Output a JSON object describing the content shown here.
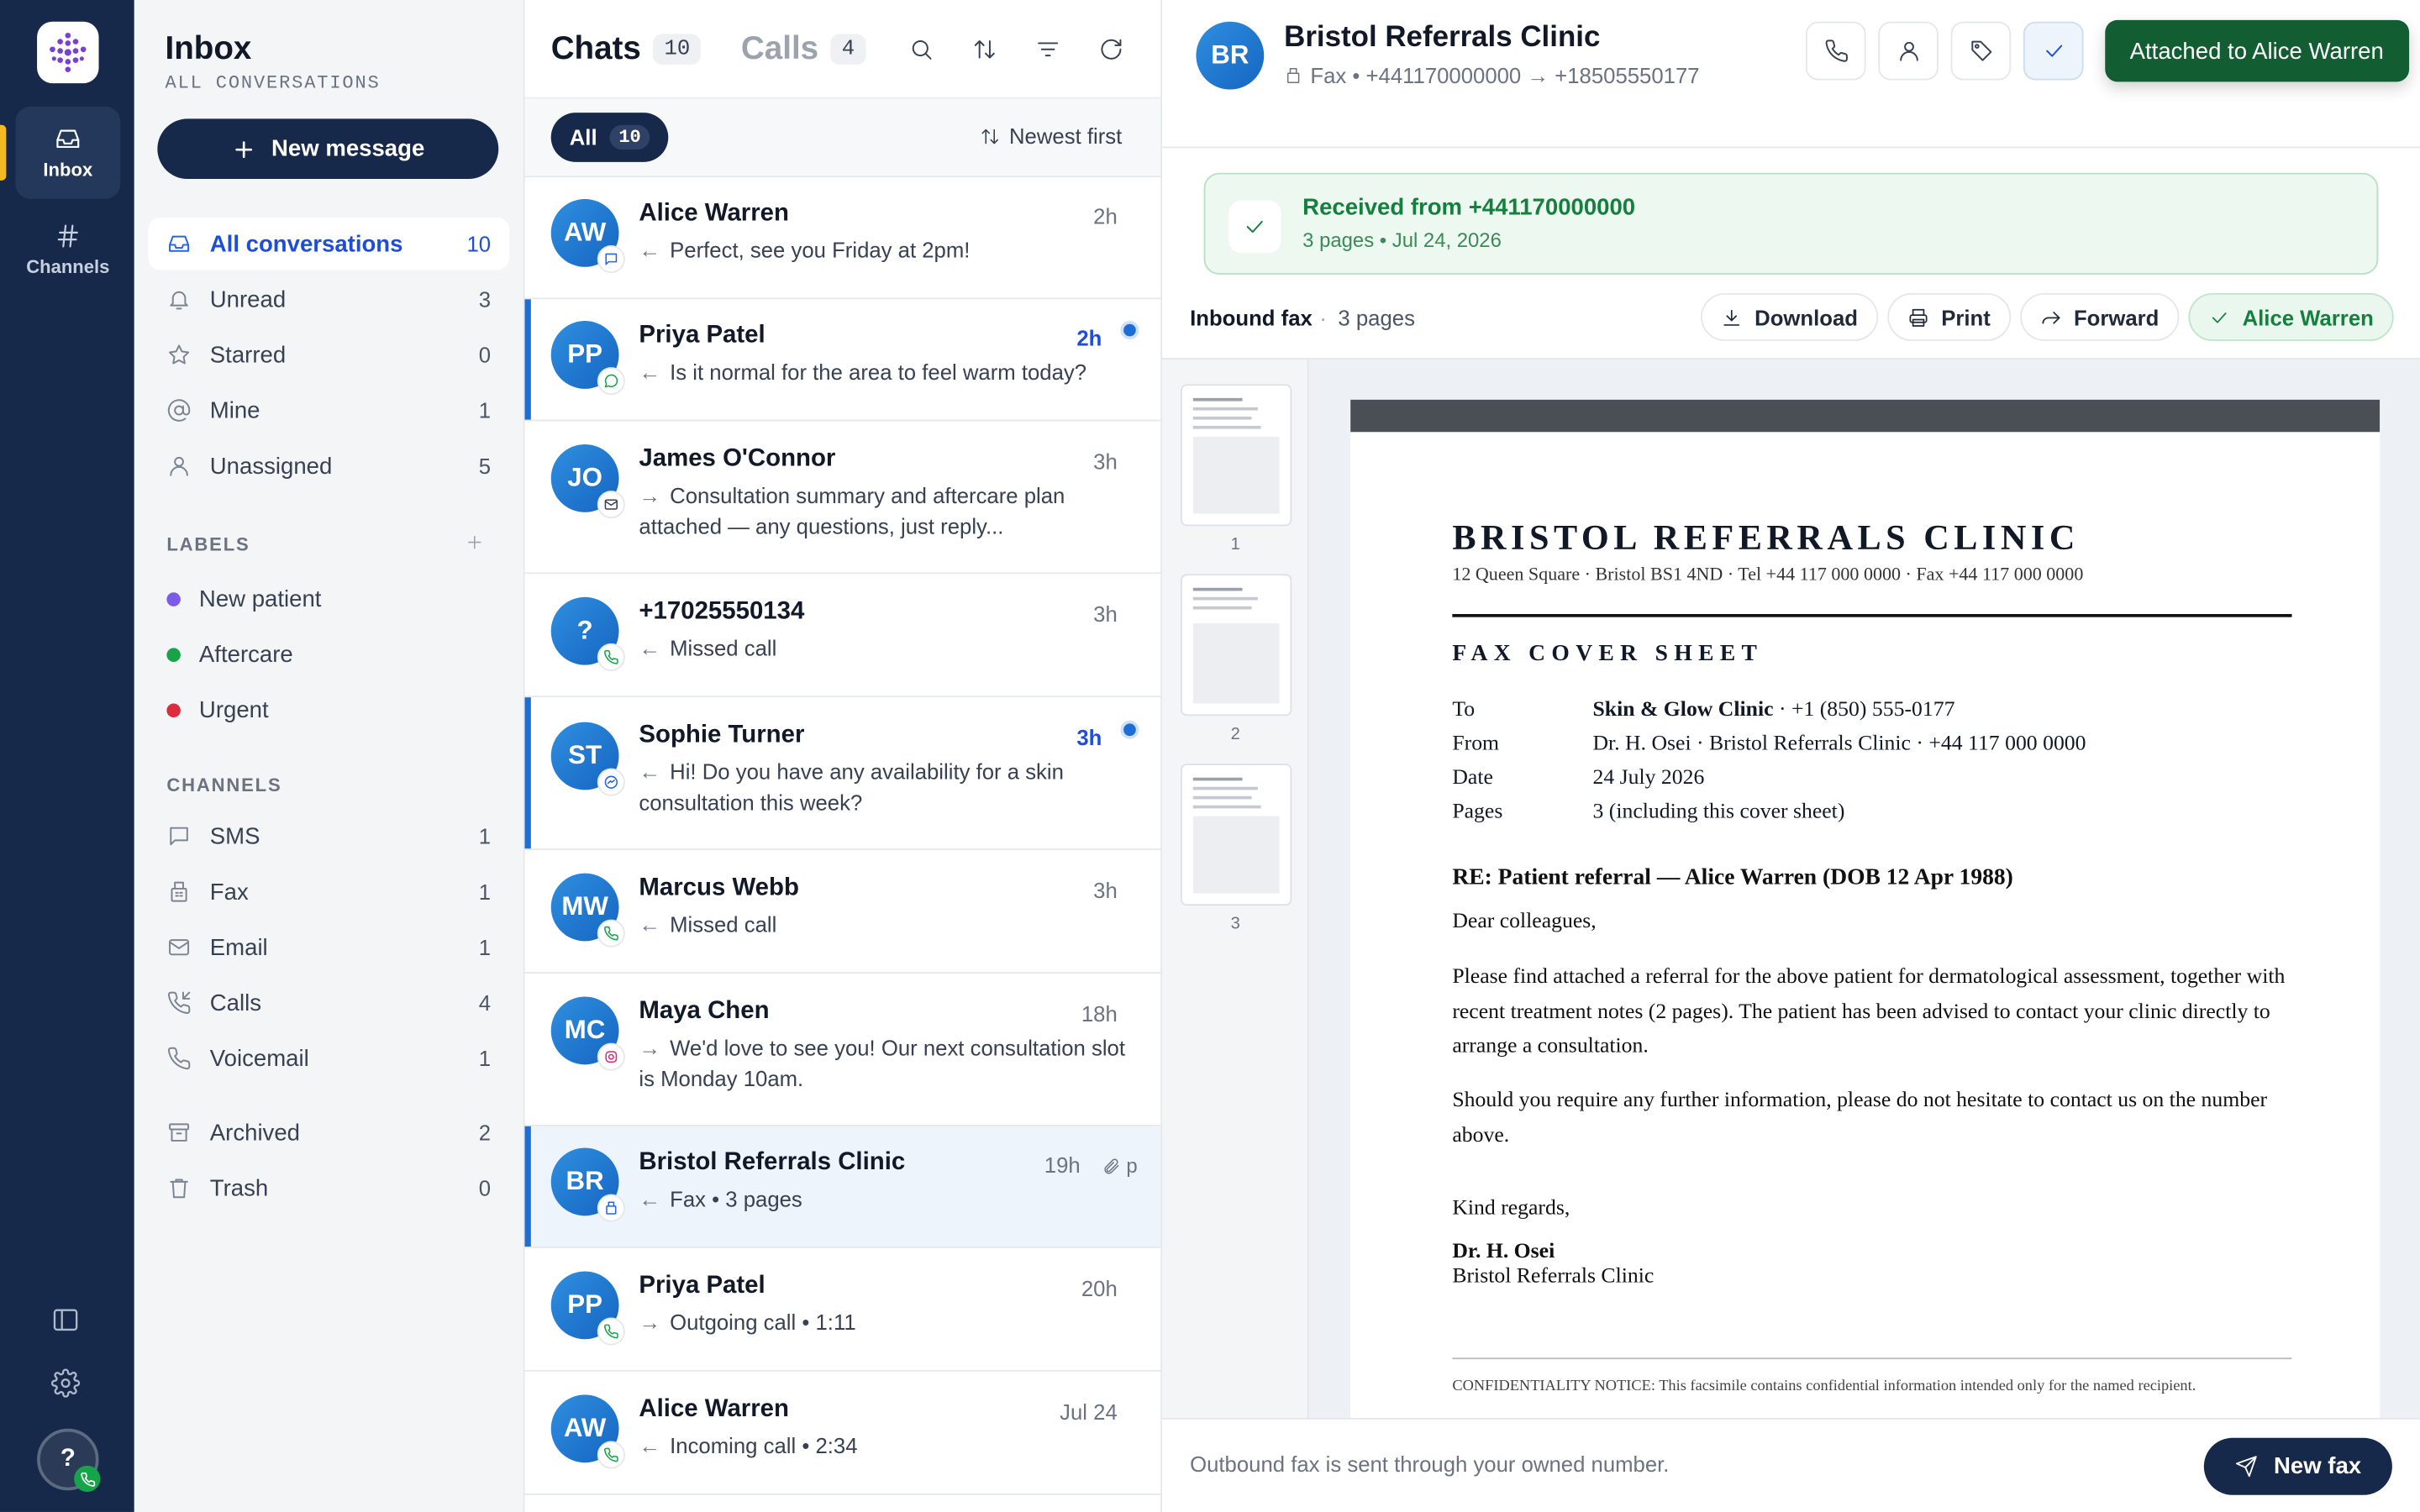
{
  "rail": {
    "items": [
      {
        "label": "Inbox"
      },
      {
        "label": "Channels"
      }
    ],
    "user_initial": "?"
  },
  "nav": {
    "title": "Inbox",
    "subtitle": "ALL CONVERSATIONS",
    "new_message": "New message",
    "folders": [
      {
        "label": "All conversations",
        "count": "10"
      },
      {
        "label": "Unread",
        "count": "3"
      },
      {
        "label": "Starred",
        "count": "0"
      },
      {
        "label": "Mine",
        "count": "1"
      },
      {
        "label": "Unassigned",
        "count": "5"
      }
    ],
    "labels_heading": "LABELS",
    "labels": [
      {
        "label": "New patient",
        "color": "#7c5ce6"
      },
      {
        "label": "Aftercare",
        "color": "#16a34a"
      },
      {
        "label": "Urgent",
        "color": "#dc2c3e"
      }
    ],
    "channels_heading": "CHANNELS",
    "channels": [
      {
        "label": "SMS",
        "count": "1"
      },
      {
        "label": "Fax",
        "count": "1"
      },
      {
        "label": "Email",
        "count": "1"
      },
      {
        "label": "Calls",
        "count": "4"
      },
      {
        "label": "Voicemail",
        "count": "1"
      }
    ],
    "bottom": [
      {
        "label": "Archived",
        "count": "2"
      },
      {
        "label": "Trash",
        "count": "0"
      }
    ]
  },
  "list": {
    "tab_chats": "Chats",
    "tab_chats_count": "10",
    "tab_calls": "Calls",
    "tab_calls_count": "4",
    "filter_all": "All",
    "filter_all_count": "10",
    "sort_label": "Newest first",
    "conversations": [
      {
        "initials": "AW",
        "name": "Alice Warren",
        "time": "2h",
        "preview": "Perfect, see you Friday at 2pm!",
        "dir": "in",
        "channel": "sms-icon"
      },
      {
        "initials": "PP",
        "name": "Priya Patel",
        "time": "2h",
        "preview": "Is it normal for the area to feel warm today?",
        "dir": "in",
        "channel": "whatsapp-icon"
      },
      {
        "initials": "JO",
        "name": "James O'Connor",
        "time": "3h",
        "preview": "Consultation summary and aftercare plan attached — any questions, just reply...",
        "dir": "out",
        "channel": "email-icon"
      },
      {
        "initials": "?",
        "name": "+17025550134",
        "time": "3h",
        "preview": "Missed call",
        "dir": "in",
        "channel": "phone-icon"
      },
      {
        "initials": "ST",
        "name": "Sophie Turner",
        "time": "3h",
        "preview": "Hi! Do you have any availability for a skin consultation this week?",
        "dir": "in",
        "channel": "messenger-icon"
      },
      {
        "initials": "MW",
        "name": "Marcus Webb",
        "time": "3h",
        "preview": "Missed call",
        "dir": "in",
        "channel": "phone-icon"
      },
      {
        "initials": "MC",
        "name": "Maya Chen",
        "time": "18h",
        "preview": "We'd love to see you! Our next consultation slot is Monday 10am.",
        "dir": "out",
        "channel": "instagram-icon"
      },
      {
        "initials": "BR",
        "name": "Bristol Referrals Clinic",
        "time": "19h",
        "preview": "Fax • 3 pages",
        "dir": "in",
        "channel": "fax-icon",
        "extra": "p"
      },
      {
        "initials": "PP",
        "name": "Priya Patel",
        "time": "20h",
        "preview": "Outgoing call • 1:11",
        "dir": "out",
        "channel": "phone-icon"
      },
      {
        "initials": "AW",
        "name": "Alice Warren",
        "time": "Jul 24",
        "preview": "Incoming call • 2:34",
        "dir": "in",
        "channel": "phone-icon"
      }
    ]
  },
  "detail": {
    "initials": "BR",
    "title": "Bristol Referrals Clinic",
    "subtitle": "Fax • +441170000000 → +18505550177",
    "toast": "Attached to Alice Warren",
    "received_title": "Received from +441170000000",
    "received_sub": "3 pages • Jul 24, 2026",
    "fax_label": "Inbound fax",
    "fax_sep": "·",
    "fax_pages": "3 pages",
    "actions": {
      "download": "Download",
      "print": "Print",
      "forward": "Forward",
      "attached": "Alice Warren"
    },
    "thumbs": [
      "1",
      "2",
      "3"
    ],
    "footer_msg": "Outbound fax is sent through your owned number.",
    "new_fax": "New fax"
  },
  "fax": {
    "title": "BRISTOL REFERRALS CLINIC",
    "address": "12 Queen Square · Bristol BS1 4ND · Tel +44 117 000 0000 · Fax +44 117 000 0000",
    "cover": "FAX COVER SHEET",
    "to_label": "To",
    "to_name": "Skin & Glow Clinic",
    "to_rest": " · +1 (850) 555-0177",
    "from_label": "From",
    "from_value": "Dr. H. Osei · Bristol Referrals Clinic · +44 117 000 0000",
    "date_label": "Date",
    "date_value": "24 July 2026",
    "pages_label": "Pages",
    "pages_value": "3 (including this cover sheet)",
    "re": "RE: Patient referral — Alice Warren (DOB 12 Apr 1988)",
    "greeting": "Dear colleagues,",
    "p1": "Please find attached a referral for the above patient for dermatological assessment, together with recent treatment notes (2 pages). The patient has been advised to contact your clinic directly to arrange a consultation.",
    "p2": "Should you require any further information, please do not hesitate to contact us on the number above.",
    "closing": "Kind regards,",
    "sig_name": "Dr. H. Osei",
    "sig_org": "Bristol Referrals Clinic",
    "confidential": "CONFIDENTIALITY NOTICE: This facsimile contains confidential information intended only for the named recipient."
  }
}
